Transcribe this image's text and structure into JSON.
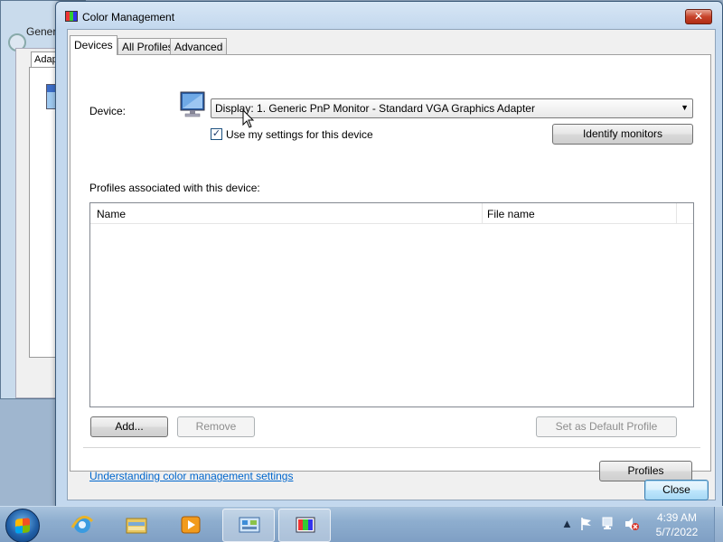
{
  "background_window": {
    "title": "Generi",
    "tab": "Adap"
  },
  "dialog": {
    "title": "Color Management",
    "close_glyph": "✕",
    "tabs": [
      {
        "label": "Devices",
        "active": true
      },
      {
        "label": "All Profiles",
        "active": false
      },
      {
        "label": "Advanced",
        "active": false
      }
    ],
    "device_label": "Device:",
    "device_selected": "Display: 1. Generic PnP Monitor - Standard VGA Graphics Adapter",
    "use_settings_label": "Use my settings for this device",
    "use_settings_checked": true,
    "identify_button": "Identify monitors",
    "profiles_label": "Profiles associated with this device:",
    "list_columns": [
      "Name",
      "File name"
    ],
    "list_rows": [],
    "add_button": "Add...",
    "remove_button": "Remove",
    "default_profile_button": "Set as Default Profile",
    "link_text": "Understanding color management settings",
    "profiles_button": "Profiles",
    "close_button": "Close"
  },
  "taskbar": {
    "pinned": [
      {
        "name": "internet-explorer-icon"
      },
      {
        "name": "windows-explorer-icon"
      },
      {
        "name": "media-player-icon"
      },
      {
        "name": "control-panel-icon",
        "active": true
      },
      {
        "name": "color-management-icon",
        "active": true
      }
    ],
    "tray_icons": [
      "show-hidden-icons-icon",
      "action-center-flag-icon",
      "network-icon",
      "volume-muted-icon"
    ],
    "time": "4:39 AM",
    "date": "5/7/2022"
  },
  "colors": {
    "link": "#0066cc",
    "close_red": "#c7432a",
    "default_button_blue": "#3c7fb1"
  }
}
